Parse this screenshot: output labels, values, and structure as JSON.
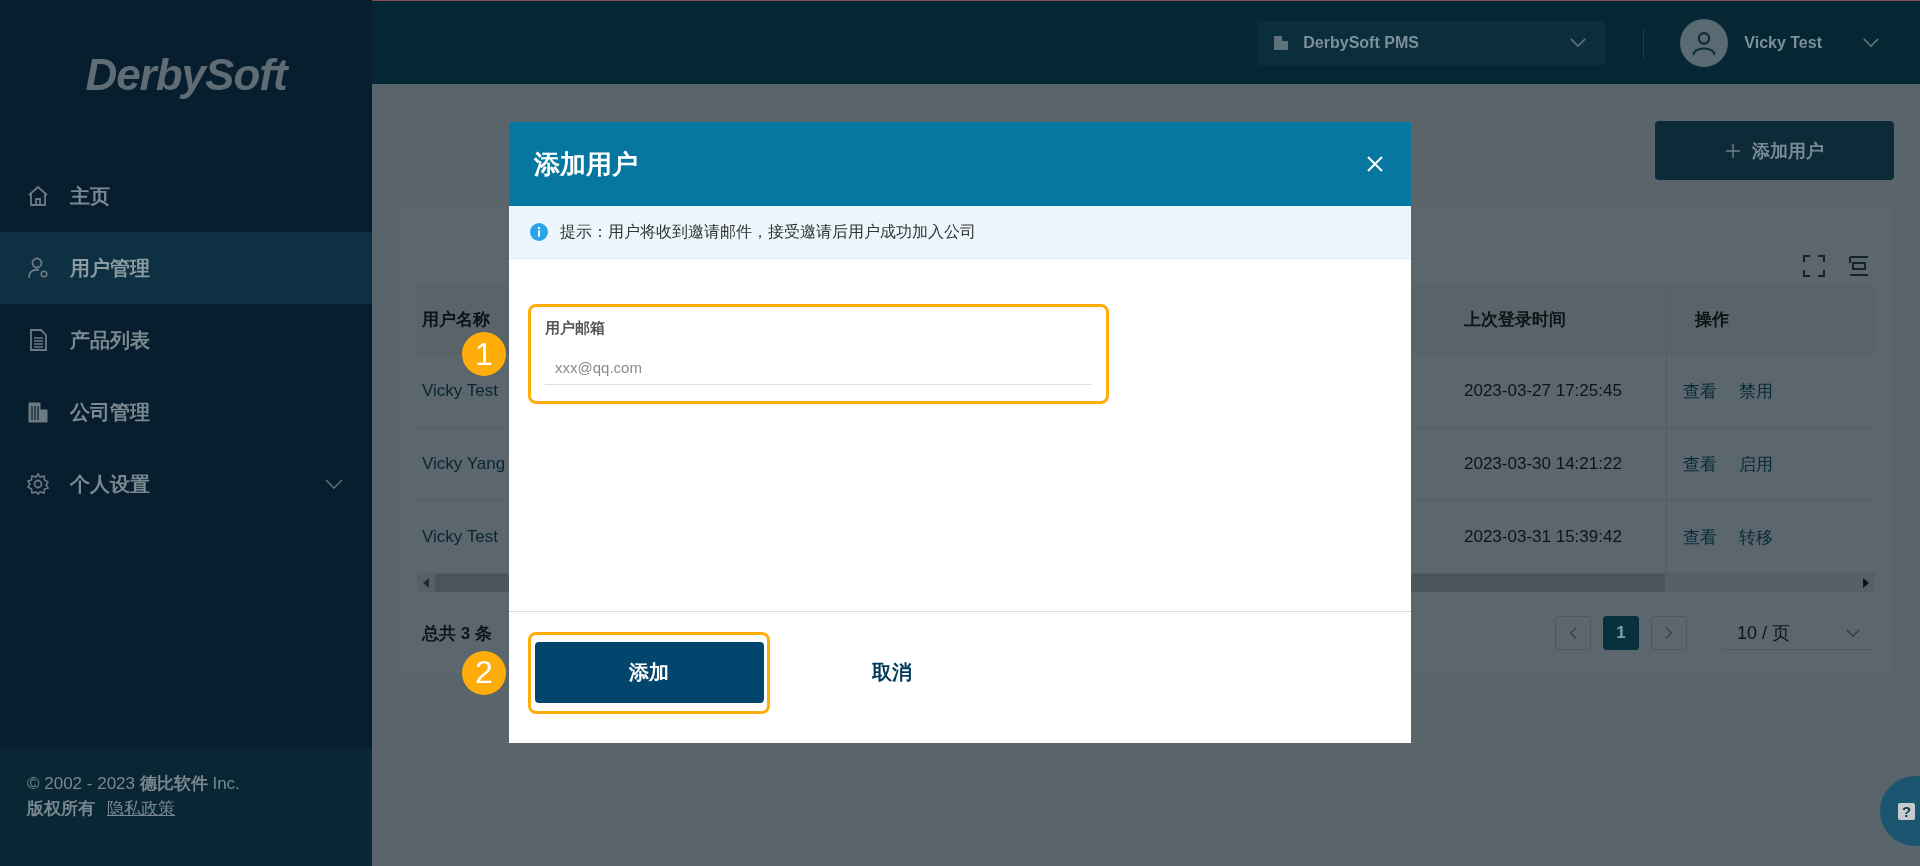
{
  "header": {
    "company": "DerbySoft PMS",
    "user_name": "Vicky Test"
  },
  "sidebar": {
    "logo": "DerbySoft",
    "items": [
      {
        "label": "主页",
        "kind": "link",
        "selected": false
      },
      {
        "label": "用户管理",
        "kind": "link",
        "selected": true
      },
      {
        "label": "产品列表",
        "kind": "link",
        "selected": false
      },
      {
        "label": "公司管理",
        "kind": "link",
        "selected": false
      },
      {
        "label": "个人设置",
        "kind": "group",
        "selected": false,
        "expanded": false
      }
    ],
    "footer": {
      "copyright": "© 2002 - 2023 **德比软件** Inc.",
      "rights": "版权所有",
      "privacy_link": "隐私政策"
    }
  },
  "page": {
    "add_user_button": "添加用户",
    "table": {
      "columns": [
        "用户名称",
        "上次登录时间",
        "操作"
      ],
      "rows": [
        {
          "name": "Vicky Test",
          "last_login": "2023-03-27 17:25:45",
          "actions": [
            "查看",
            "禁用"
          ]
        },
        {
          "name": "Vicky Yang",
          "last_login": "2023-03-30 14:21:22",
          "actions": [
            "查看",
            "启用"
          ]
        },
        {
          "name": "Vicky Test",
          "last_login": "2023-03-31 15:39:42",
          "actions": [
            "查看",
            "转移"
          ]
        }
      ]
    },
    "pagination": {
      "total": "总共 3 条",
      "pages": [
        {
          "label": "1",
          "selected": true
        }
      ],
      "page_size": "10 / 页"
    }
  },
  "modal": {
    "title": "添加用户",
    "notice": "提示：用户将收到邀请邮件，接受邀请后用户成功加入公司",
    "fields": [
      {
        "label": "用户邮箱",
        "placeholder": "xxx@qq.com",
        "annotation": "1"
      }
    ],
    "buttons": [
      {
        "label": "添加",
        "kind": "primary",
        "annotation": "2"
      },
      {
        "label": "取消",
        "kind": "text"
      }
    ]
  },
  "help_button": {
    "label": "?"
  }
}
